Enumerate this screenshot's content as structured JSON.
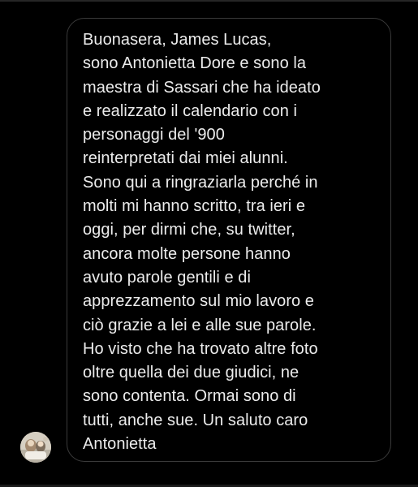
{
  "conversation": {
    "message": {
      "lines": [
        "Buonasera, James Lucas,",
        "sono Antonietta Dore e sono la",
        "maestra di Sassari che ha ideato",
        "e realizzato il calendario con i",
        "personaggi del '900",
        "reinterpretati dai miei alunni.",
        "Sono qui a ringraziarla perché in",
        "molti mi hanno scritto, tra ieri e",
        "oggi, per dirmi che, su twitter,",
        "ancora molte persone hanno",
        "avuto parole gentili e di",
        "apprezzamento sul mio lavoro e",
        "ciò grazie a lei e alle sue parole.",
        "Ho visto che ha trovato altre foto",
        "oltre quella dei due giudici, ne",
        "sono contenta. Ormai sono di",
        "tutti, anche sue. Un saluto caro",
        "Antonietta"
      ]
    },
    "sender": {
      "avatar_icon": "profile-photo-icon"
    }
  },
  "colors": {
    "background": "#000000",
    "bubble_border": "#3a3a3a",
    "text": "#ececec"
  }
}
